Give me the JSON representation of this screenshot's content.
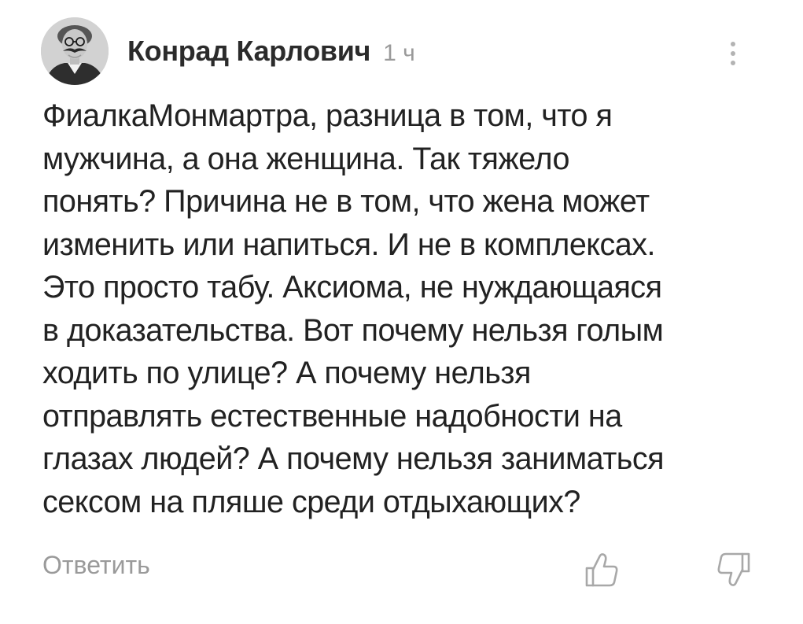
{
  "comment": {
    "author": "Конрад Карлович",
    "timestamp": "1 ч",
    "body_lines": [
      "ФиалкаМонмартра, разница в том, что я",
      "мужчина, а она женщина. Так тяжело",
      "понять? Причина не в том, что жена может",
      "изменить или напиться. И не в комплексах.",
      "Это просто табу. Аксиома, не нуждающаяся",
      "в доказательства. Вот почему нельзя голым",
      "ходить по улице? А почему нельзя",
      "отправлять естественные надобности на",
      "глазах людей? А почему нельзя заниматься",
      "сексом на пляше среди отдыхающих?"
    ],
    "reply_label": "Ответить"
  },
  "icons": {
    "more": "more-vertical-icon",
    "like": "thumbs-up-icon",
    "dislike": "thumbs-down-icon"
  },
  "colors": {
    "text": "#222222",
    "muted": "#9a9a9a",
    "icon": "#b3b3b3",
    "background": "#ffffff"
  }
}
